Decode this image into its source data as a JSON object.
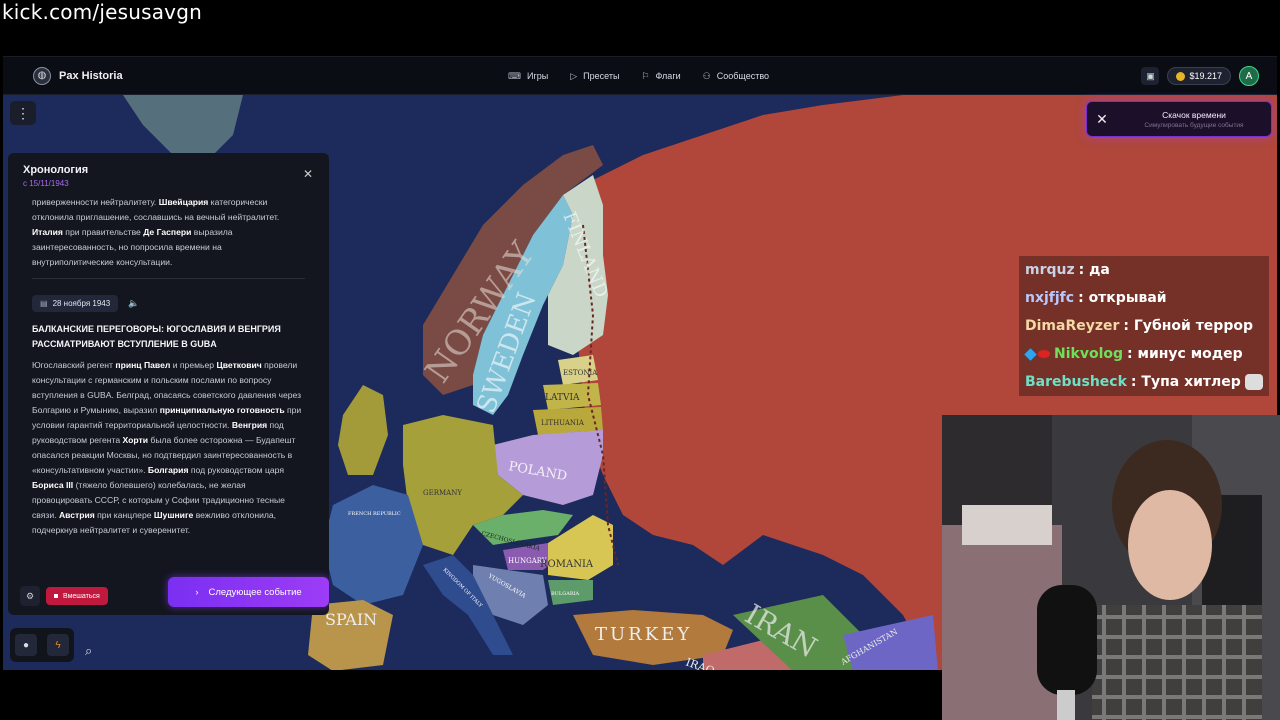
{
  "stream": {
    "url": "kick.com/jesusavgn"
  },
  "app": {
    "name": "Pax Historia",
    "nav": [
      {
        "label": "Игры",
        "icon": "gamepad-icon"
      },
      {
        "label": "Пресеты",
        "icon": "play-icon"
      },
      {
        "label": "Флаги",
        "icon": "flag-icon"
      },
      {
        "label": "Сообщество",
        "icon": "people-icon"
      }
    ],
    "balance": "$19.217",
    "avatar_letter": "A"
  },
  "time_jump": {
    "title": "Скачок времени",
    "subtitle": "Симулировать будущие события"
  },
  "chronology": {
    "title": "Хронология",
    "since": "с 15/11/1943",
    "prev_paragraph": {
      "t1": "приверженности нейтралитету. ",
      "b1": "Швейцария",
      "t2": " категорически отклонила приглашение, сославшись на вечный нейтралитет. ",
      "b2": "Италия",
      "t3": " при правительстве ",
      "b3": "Де Гаспери",
      "t4": " выразила заинтересованность, но попросила времени на внутриполитические консультации."
    },
    "event": {
      "date": "28 ноября 1943",
      "title": "Балканские переговоры: Югославия и Венгрия рассматривают вступление в GUBA",
      "p": {
        "t1": "Югославский регент ",
        "b1": "принц Павел",
        "t2": " и премьер ",
        "b2": "Цветкович",
        "t3": " провели консультации с германским и польским послами по вопросу вступления в GUBA. Белград, опасаясь советского давления через Болгарию и Румынию, выразил ",
        "b3": "принципиальную готовность",
        "t4": " при условии гарантий территориальной целостности. ",
        "b4": "Венгрия",
        "t5": " под руководством регента ",
        "b5": "Хорти",
        "t6": " была более осторожна — Будапешт опасался реакции Москвы, но подтвердил заинтересованность в «консультативном участии». ",
        "b6": "Болгария",
        "t7": " под руководством царя ",
        "b7": "Бориса III",
        "t8": " (тяжело болевшего) колебалась, не желая провоцировать СССР, с которым у Софии традиционно тесные связи. ",
        "b8": "Австрия",
        "t9": " при канцлере ",
        "b9": "Шушниге",
        "t10": " вежливо отклонила, подчеркнув нейтралитет и суверенитет."
      }
    },
    "intervene_label": "Вмешаться",
    "next_label": "Следующее событие"
  },
  "map_labels": {
    "norway": "NORWAY",
    "sweden": "SWEDEN",
    "finland": "FINLAND",
    "estonia": "ESTONIA",
    "latvia": "LATVIA",
    "lithuania": "LITHUANIA",
    "poland": "POLAND",
    "czechoslovakia": "CZECHOSLOVAKIA",
    "hungary": "HUNGARY",
    "romania": "ROMANIA",
    "yugoslavia": "YUGOSLAVIA",
    "bulgaria": "BULGARIA",
    "turkey": "TURKEY",
    "spain": "SPAIN",
    "iraq": "IRAQ",
    "iran": "IRAN",
    "afghanistan": "AFGHANISTAN",
    "france": "FRENCH REPUBLIC",
    "italy": "KINGDOM OF ITALY",
    "germany": "GERMANY"
  },
  "chat": [
    {
      "user": "mrquz",
      "color": "#c8d2e6",
      "msg": "да"
    },
    {
      "user": "nxjfjfc",
      "color": "#b8c8ff",
      "msg": "открывай"
    },
    {
      "user": "DimaReyzer",
      "color": "#f4d9a6",
      "msg": "Губной террор"
    },
    {
      "user": "Nikvolog",
      "color": "#6ee05a",
      "msg": "минус модер"
    },
    {
      "user": "Barebusheck",
      "color": "#6fe0c8",
      "msg": "Тупа хитлер"
    }
  ],
  "colors": {
    "accent": "#8b36f4",
    "ocean": "#1c2a5c",
    "soviet": "#b0473a",
    "intervene": "#c1193e"
  }
}
